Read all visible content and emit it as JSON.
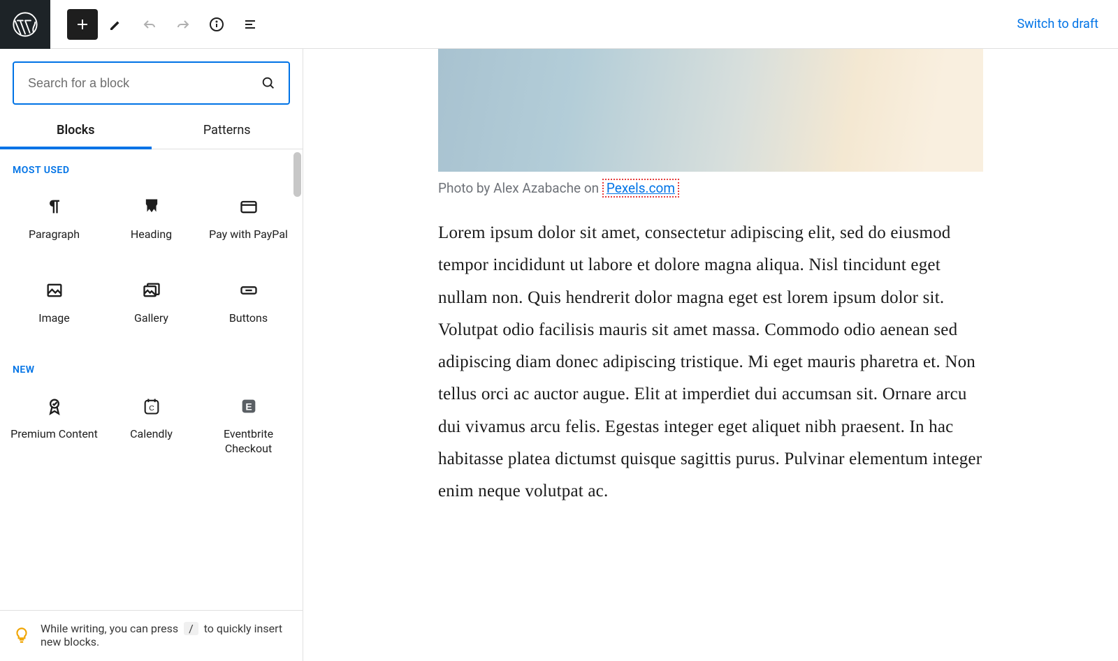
{
  "header": {
    "draft_link": "Switch to draft"
  },
  "sidebar": {
    "search_placeholder": "Search for a block",
    "tabs": [
      "Blocks",
      "Patterns"
    ],
    "active_tab": 0,
    "sections": [
      {
        "title": "MOST USED",
        "items": [
          {
            "icon": "paragraph-icon",
            "label": "Paragraph"
          },
          {
            "icon": "heading-icon",
            "label": "Heading"
          },
          {
            "icon": "card-icon",
            "label": "Pay with PayPal"
          },
          {
            "icon": "image-icon",
            "label": "Image"
          },
          {
            "icon": "gallery-icon",
            "label": "Gallery"
          },
          {
            "icon": "button-icon",
            "label": "Buttons"
          }
        ]
      },
      {
        "title": "NEW",
        "items": [
          {
            "icon": "ribbon-icon",
            "label": "Premium Content"
          },
          {
            "icon": "calendar-icon",
            "label": "Calendly"
          },
          {
            "icon": "eventbrite-icon",
            "label": "Eventbrite Checkout"
          }
        ]
      }
    ],
    "tip_pre": "While writing, you can press",
    "tip_key": "/",
    "tip_post": "to quickly insert new blocks."
  },
  "document": {
    "caption_prefix": "Photo by Alex Azabache on ",
    "caption_link": "Pexels.com",
    "body": "Lorem ipsum dolor sit amet, consectetur adipiscing elit, sed do eiusmod tempor incididunt ut labore et dolore magna aliqua. Nisl tincidunt eget nullam non. Quis hendrerit dolor magna eget est lorem ipsum dolor sit. Volutpat odio facilisis mauris sit amet massa. Commodo odio aenean sed adipiscing diam donec adipiscing tristique. Mi eget mauris pharetra et. Non tellus orci ac auctor augue. Elit at imperdiet dui accumsan sit. Ornare arcu dui vivamus arcu felis. Egestas integer eget aliquet nibh praesent. In hac habitasse platea dictumst quisque sagittis purus. Pulvinar elementum integer enim neque volutpat ac."
  }
}
